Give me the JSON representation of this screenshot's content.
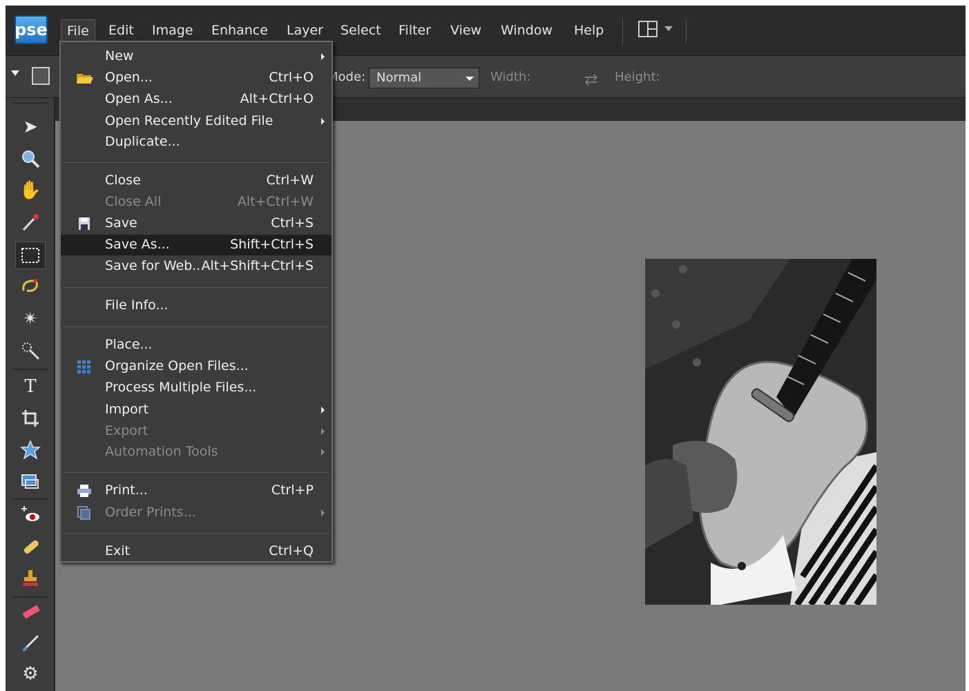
{
  "app": {
    "logo_text": "pse"
  },
  "menubar": {
    "items": [
      "File",
      "Edit",
      "Image",
      "Enhance",
      "Layer",
      "Select",
      "Filter",
      "View",
      "Window",
      "Help"
    ]
  },
  "options_bar": {
    "mode_label": "Mode:",
    "mode_value": "Normal",
    "width_label": "Width:",
    "height_label": "Height:"
  },
  "file_menu": {
    "new": {
      "label": "New"
    },
    "open": {
      "label": "Open...",
      "shortcut": "Ctrl+O"
    },
    "open_as": {
      "label": "Open As...",
      "shortcut": "Alt+Ctrl+O"
    },
    "open_recent": {
      "label": "Open Recently Edited File"
    },
    "duplicate": {
      "label": "Duplicate..."
    },
    "close": {
      "label": "Close",
      "shortcut": "Ctrl+W"
    },
    "close_all": {
      "label": "Close All",
      "shortcut": "Alt+Ctrl+W"
    },
    "save": {
      "label": "Save",
      "shortcut": "Ctrl+S"
    },
    "save_as": {
      "label": "Save As...",
      "shortcut": "Shift+Ctrl+S"
    },
    "save_web": {
      "label": "Save for Web...",
      "shortcut": "Alt+Shift+Ctrl+S"
    },
    "file_info": {
      "label": "File Info..."
    },
    "place": {
      "label": "Place..."
    },
    "organize": {
      "label": "Organize Open Files..."
    },
    "process": {
      "label": "Process Multiple Files..."
    },
    "import": {
      "label": "Import"
    },
    "export": {
      "label": "Export"
    },
    "automation": {
      "label": "Automation Tools"
    },
    "print": {
      "label": "Print...",
      "shortcut": "Ctrl+P"
    },
    "order_prints": {
      "label": "Order Prints..."
    },
    "exit": {
      "label": "Exit",
      "shortcut": "Ctrl+Q"
    }
  },
  "colors": {
    "highlight": "#1f1f1f",
    "menu_bg": "#3c3c3c",
    "canvas_bg": "#7a7a7a",
    "logo_blue": "#2f86d8"
  }
}
